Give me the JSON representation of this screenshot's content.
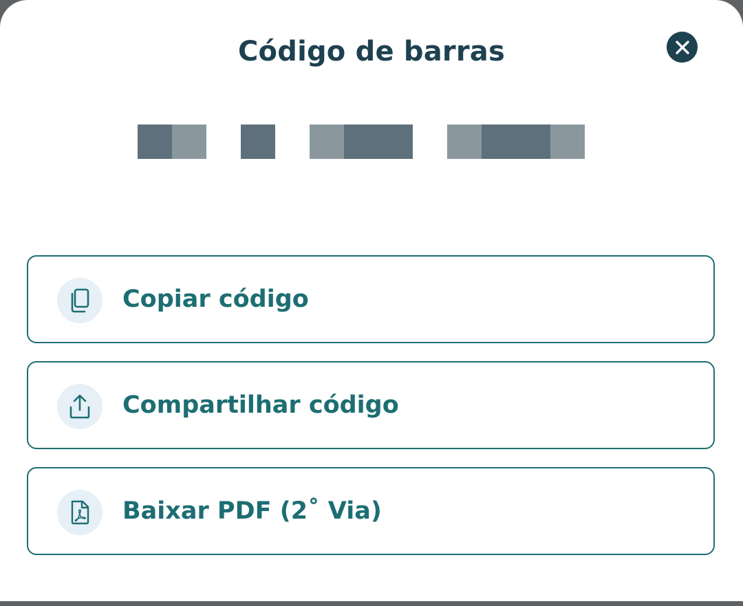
{
  "modal": {
    "title": "Código de barras",
    "close_icon": "close-icon"
  },
  "code": {
    "state": "obscured",
    "colors": {
      "dark": "#5e707b",
      "light": "#8a989e"
    }
  },
  "actions": [
    {
      "label": "Copiar código",
      "icon": "copy-icon"
    },
    {
      "label": "Compartilhar código",
      "icon": "share-icon"
    },
    {
      "label": "Baixar PDF (2˚ Via)",
      "icon": "pdf-file-icon"
    }
  ],
  "colors": {
    "title": "#1e4150",
    "accent": "#1d6e73",
    "icon_bg": "#e6f0f6",
    "close_bg": "#1e4150"
  }
}
